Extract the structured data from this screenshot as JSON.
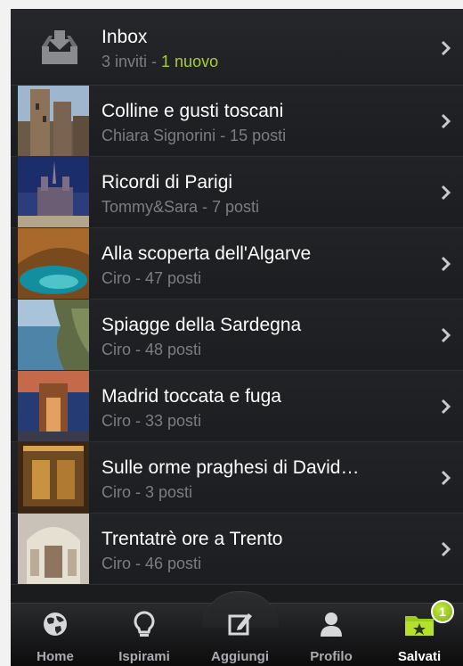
{
  "list": {
    "inbox": {
      "title": "Inbox",
      "count_text": "3 inviti - ",
      "new_text": "1 nuovo"
    },
    "items": [
      {
        "title": "Colline e gusti toscani",
        "subtitle": "Chiara Signorini - 15 posti"
      },
      {
        "title": "Ricordi di Parigi",
        "subtitle": "Tommy&Sara - 7 posti"
      },
      {
        "title": "Alla scoperta dell'Algarve",
        "subtitle": "Ciro - 47 posti"
      },
      {
        "title": "Spiagge della Sardegna",
        "subtitle": "Ciro - 48 posti"
      },
      {
        "title": "Madrid toccata e fuga",
        "subtitle": "Ciro - 33 posti"
      },
      {
        "title": "Sulle orme praghesi di David…",
        "subtitle": "Ciro - 3 posti"
      },
      {
        "title": "Trentatrè ore a Trento",
        "subtitle": "Ciro - 46 posti"
      }
    ]
  },
  "tabbar": {
    "tabs": [
      {
        "label": "Home",
        "icon": "globe-icon"
      },
      {
        "label": "Ispirami",
        "icon": "lightbulb-icon"
      },
      {
        "label": "Aggiungi",
        "icon": "compose-icon"
      },
      {
        "label": "Profilo",
        "icon": "person-icon"
      },
      {
        "label": "Salvati",
        "icon": "saved-folder-icon",
        "badge": "1",
        "active": true
      }
    ]
  },
  "colors": {
    "accent": "#a8cc33",
    "background": "#1b1c1e",
    "subtitle": "#7c7d80"
  }
}
